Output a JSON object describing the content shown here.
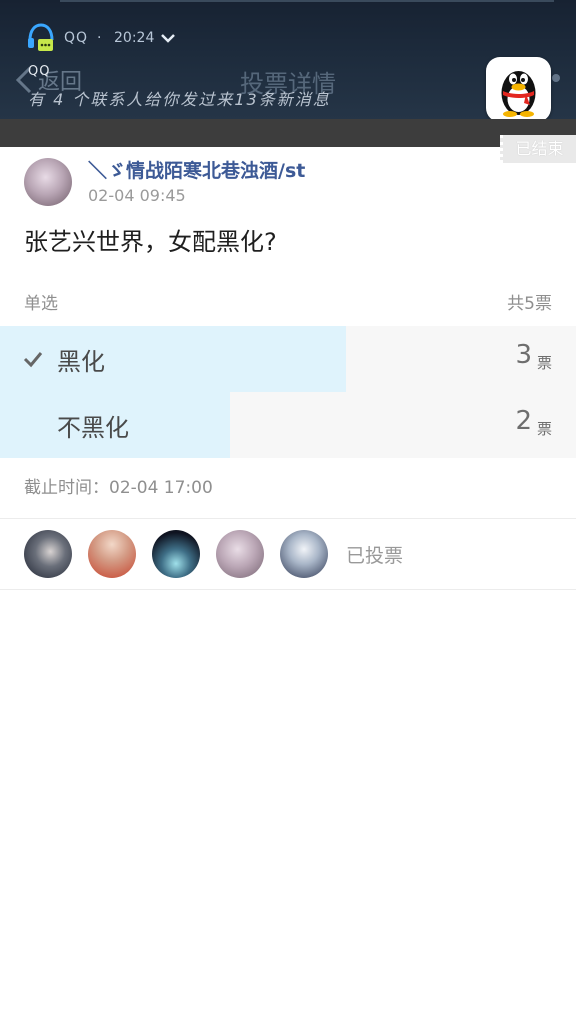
{
  "notification": {
    "app_name": "QQ",
    "separator": "·",
    "time": "20:24",
    "title": "QQ",
    "body": "有 4 个联系人给你发过来13条新消息"
  },
  "header": {
    "back_label": "返回",
    "title": "投票详情",
    "ended_badge": "已结束"
  },
  "post": {
    "author_name": "＼ゞ情战陌寒北巷浊酒/st",
    "time": "02-04 09:45",
    "question": "张艺兴世界，女配黑化?"
  },
  "poll": {
    "mode_label": "单选",
    "total_label": "共5票",
    "options": [
      {
        "label": "黑化",
        "count": "3",
        "unit": "票",
        "fraction": 0.6,
        "selected": true
      },
      {
        "label": "不黑化",
        "count": "2",
        "unit": "票",
        "fraction": 0.4,
        "selected": false
      }
    ],
    "deadline": "截止时间：02-04 17:00",
    "voted_label": "已投票"
  },
  "colors": {
    "author_link": "#3d5a96",
    "option_fill": "#dff3fc",
    "option_bg": "#f7f7f7"
  },
  "icons": [
    "headset-chat-icon",
    "chevron-down-icon",
    "back-arrow-icon",
    "qq-penguin-icon",
    "checkmark-icon"
  ]
}
